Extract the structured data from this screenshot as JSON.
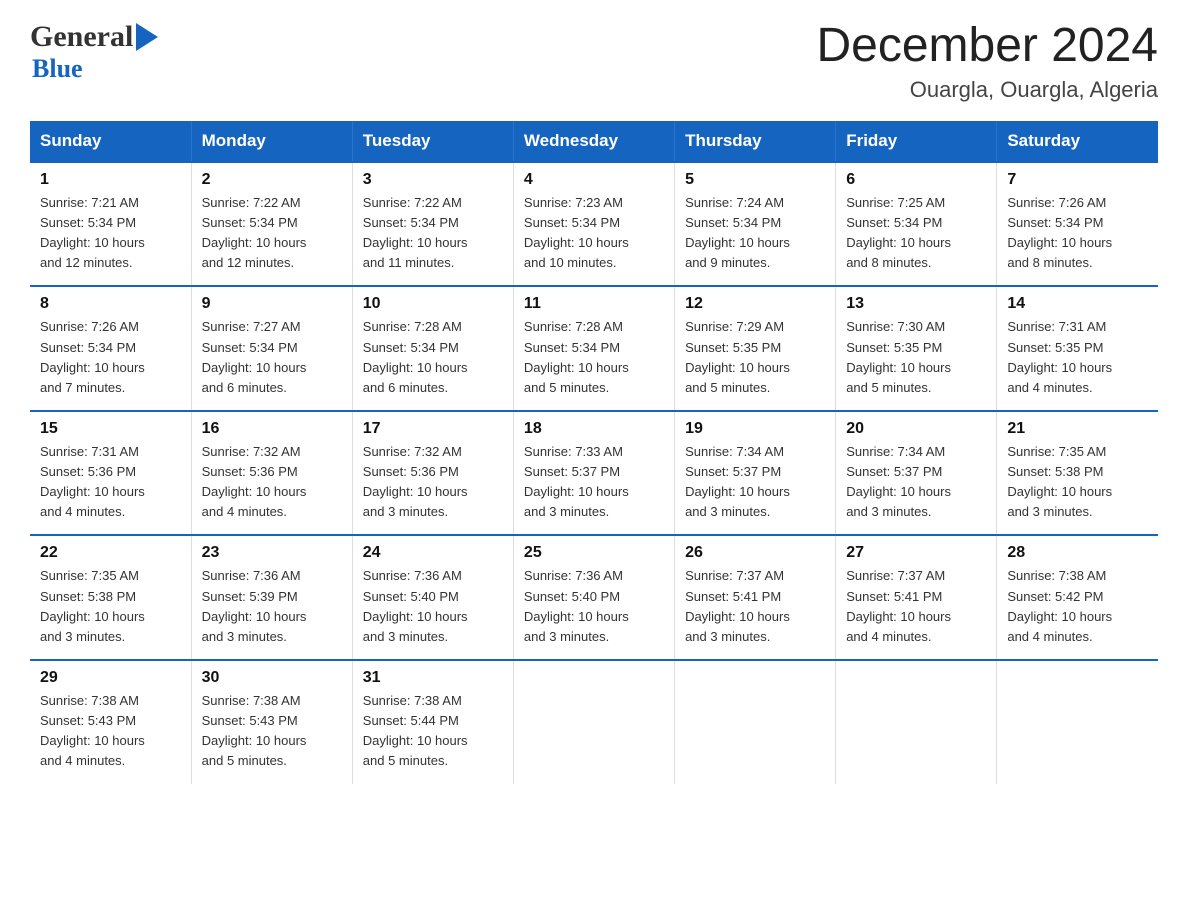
{
  "header": {
    "logo_general": "General",
    "logo_blue": "Blue",
    "month_title": "December 2024",
    "location": "Ouargla, Ouargla, Algeria"
  },
  "days_of_week": [
    "Sunday",
    "Monday",
    "Tuesday",
    "Wednesday",
    "Thursday",
    "Friday",
    "Saturday"
  ],
  "weeks": [
    [
      {
        "day": "1",
        "sunrise": "7:21 AM",
        "sunset": "5:34 PM",
        "daylight": "10 hours and 12 minutes."
      },
      {
        "day": "2",
        "sunrise": "7:22 AM",
        "sunset": "5:34 PM",
        "daylight": "10 hours and 12 minutes."
      },
      {
        "day": "3",
        "sunrise": "7:22 AM",
        "sunset": "5:34 PM",
        "daylight": "10 hours and 11 minutes."
      },
      {
        "day": "4",
        "sunrise": "7:23 AM",
        "sunset": "5:34 PM",
        "daylight": "10 hours and 10 minutes."
      },
      {
        "day": "5",
        "sunrise": "7:24 AM",
        "sunset": "5:34 PM",
        "daylight": "10 hours and 9 minutes."
      },
      {
        "day": "6",
        "sunrise": "7:25 AM",
        "sunset": "5:34 PM",
        "daylight": "10 hours and 8 minutes."
      },
      {
        "day": "7",
        "sunrise": "7:26 AM",
        "sunset": "5:34 PM",
        "daylight": "10 hours and 8 minutes."
      }
    ],
    [
      {
        "day": "8",
        "sunrise": "7:26 AM",
        "sunset": "5:34 PM",
        "daylight": "10 hours and 7 minutes."
      },
      {
        "day": "9",
        "sunrise": "7:27 AM",
        "sunset": "5:34 PM",
        "daylight": "10 hours and 6 minutes."
      },
      {
        "day": "10",
        "sunrise": "7:28 AM",
        "sunset": "5:34 PM",
        "daylight": "10 hours and 6 minutes."
      },
      {
        "day": "11",
        "sunrise": "7:28 AM",
        "sunset": "5:34 PM",
        "daylight": "10 hours and 5 minutes."
      },
      {
        "day": "12",
        "sunrise": "7:29 AM",
        "sunset": "5:35 PM",
        "daylight": "10 hours and 5 minutes."
      },
      {
        "day": "13",
        "sunrise": "7:30 AM",
        "sunset": "5:35 PM",
        "daylight": "10 hours and 5 minutes."
      },
      {
        "day": "14",
        "sunrise": "7:31 AM",
        "sunset": "5:35 PM",
        "daylight": "10 hours and 4 minutes."
      }
    ],
    [
      {
        "day": "15",
        "sunrise": "7:31 AM",
        "sunset": "5:36 PM",
        "daylight": "10 hours and 4 minutes."
      },
      {
        "day": "16",
        "sunrise": "7:32 AM",
        "sunset": "5:36 PM",
        "daylight": "10 hours and 4 minutes."
      },
      {
        "day": "17",
        "sunrise": "7:32 AM",
        "sunset": "5:36 PM",
        "daylight": "10 hours and 3 minutes."
      },
      {
        "day": "18",
        "sunrise": "7:33 AM",
        "sunset": "5:37 PM",
        "daylight": "10 hours and 3 minutes."
      },
      {
        "day": "19",
        "sunrise": "7:34 AM",
        "sunset": "5:37 PM",
        "daylight": "10 hours and 3 minutes."
      },
      {
        "day": "20",
        "sunrise": "7:34 AM",
        "sunset": "5:37 PM",
        "daylight": "10 hours and 3 minutes."
      },
      {
        "day": "21",
        "sunrise": "7:35 AM",
        "sunset": "5:38 PM",
        "daylight": "10 hours and 3 minutes."
      }
    ],
    [
      {
        "day": "22",
        "sunrise": "7:35 AM",
        "sunset": "5:38 PM",
        "daylight": "10 hours and 3 minutes."
      },
      {
        "day": "23",
        "sunrise": "7:36 AM",
        "sunset": "5:39 PM",
        "daylight": "10 hours and 3 minutes."
      },
      {
        "day": "24",
        "sunrise": "7:36 AM",
        "sunset": "5:40 PM",
        "daylight": "10 hours and 3 minutes."
      },
      {
        "day": "25",
        "sunrise": "7:36 AM",
        "sunset": "5:40 PM",
        "daylight": "10 hours and 3 minutes."
      },
      {
        "day": "26",
        "sunrise": "7:37 AM",
        "sunset": "5:41 PM",
        "daylight": "10 hours and 3 minutes."
      },
      {
        "day": "27",
        "sunrise": "7:37 AM",
        "sunset": "5:41 PM",
        "daylight": "10 hours and 4 minutes."
      },
      {
        "day": "28",
        "sunrise": "7:38 AM",
        "sunset": "5:42 PM",
        "daylight": "10 hours and 4 minutes."
      }
    ],
    [
      {
        "day": "29",
        "sunrise": "7:38 AM",
        "sunset": "5:43 PM",
        "daylight": "10 hours and 4 minutes."
      },
      {
        "day": "30",
        "sunrise": "7:38 AM",
        "sunset": "5:43 PM",
        "daylight": "10 hours and 5 minutes."
      },
      {
        "day": "31",
        "sunrise": "7:38 AM",
        "sunset": "5:44 PM",
        "daylight": "10 hours and 5 minutes."
      },
      null,
      null,
      null,
      null
    ]
  ],
  "labels": {
    "sunrise": "Sunrise:",
    "sunset": "Sunset:",
    "daylight": "Daylight:"
  }
}
